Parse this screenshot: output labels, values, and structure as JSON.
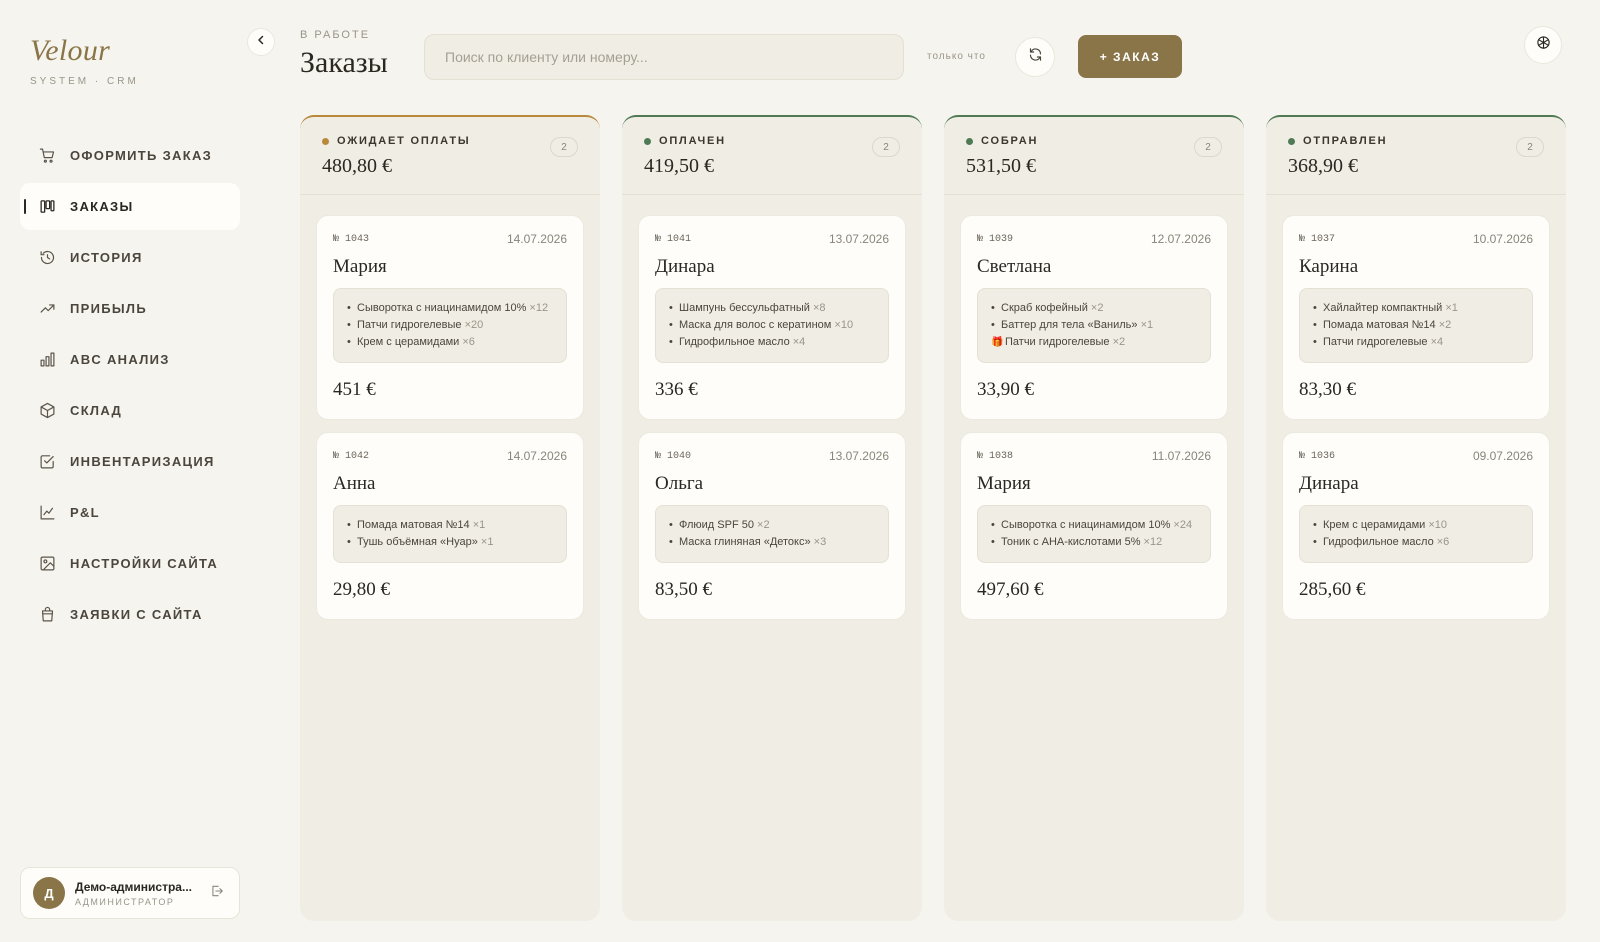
{
  "brand": {
    "name": "Velour",
    "subtitle": "SYSTEM · CRM"
  },
  "nav": [
    {
      "label": "ОФОРМИТЬ ЗАКАЗ",
      "icon": "cart-icon",
      "active": false
    },
    {
      "label": "ЗАКАЗЫ",
      "icon": "kanban-icon",
      "active": true
    },
    {
      "label": "ИСТОРИЯ",
      "icon": "history-icon",
      "active": false
    },
    {
      "label": "ПРИБЫЛЬ",
      "icon": "trending-up-icon",
      "active": false
    },
    {
      "label": "ABC АНАЛИЗ",
      "icon": "bar-chart-icon",
      "active": false
    },
    {
      "label": "СКЛАД",
      "icon": "box-icon",
      "active": false
    },
    {
      "label": "ИНВЕНТАРИЗАЦИЯ",
      "icon": "checklist-icon",
      "active": false
    },
    {
      "label": "P&L",
      "icon": "line-chart-icon",
      "active": false
    },
    {
      "label": "НАСТРОЙКИ САЙТА",
      "icon": "image-icon",
      "active": false
    },
    {
      "label": "ЗАЯВКИ С САЙТА",
      "icon": "bag-icon",
      "active": false
    }
  ],
  "user": {
    "initial": "Д",
    "name": "Демо-администра...",
    "role": "АДМИНИСТРАТОР"
  },
  "header": {
    "eyebrow": "В РАБОТЕ",
    "title": "Заказы",
    "search_placeholder": "Поиск по клиенту или номеру...",
    "updated": "только что",
    "new_order_label": "+ ЗАКАЗ"
  },
  "colors": {
    "accent": "#8a7549",
    "pending": "#b8893a",
    "done": "#4f7a55"
  },
  "columns": [
    {
      "status": "ОЖИДАЕТ ОПЛАТЫ",
      "count": "2",
      "total": "480,80 €",
      "color": "#b8893a",
      "orders": [
        {
          "number": "№ 1043",
          "date": "14.07.2026",
          "client": "Мария",
          "sum": "451 €",
          "items": [
            {
              "mark": "•",
              "name": "Сыворотка с ниацинамидом 10%",
              "qty": "×12"
            },
            {
              "mark": "•",
              "name": "Патчи гидрогелевые",
              "qty": "×20"
            },
            {
              "mark": "•",
              "name": "Крем с церамидами",
              "qty": "×6"
            }
          ]
        },
        {
          "number": "№ 1042",
          "date": "14.07.2026",
          "client": "Анна",
          "sum": "29,80 €",
          "items": [
            {
              "mark": "•",
              "name": "Помада матовая №14",
              "qty": "×1"
            },
            {
              "mark": "•",
              "name": "Тушь объёмная «Нуар»",
              "qty": "×1"
            }
          ]
        }
      ]
    },
    {
      "status": "ОПЛАЧЕН",
      "count": "2",
      "total": "419,50 €",
      "color": "#4f7a55",
      "orders": [
        {
          "number": "№ 1041",
          "date": "13.07.2026",
          "client": "Динара",
          "sum": "336 €",
          "items": [
            {
              "mark": "•",
              "name": "Шампунь бессульфатный",
              "qty": "×8"
            },
            {
              "mark": "•",
              "name": "Маска для волос с кератином",
              "qty": "×10"
            },
            {
              "mark": "•",
              "name": "Гидрофильное масло",
              "qty": "×4"
            }
          ]
        },
        {
          "number": "№ 1040",
          "date": "13.07.2026",
          "client": "Ольга",
          "sum": "83,50 €",
          "items": [
            {
              "mark": "•",
              "name": "Флюид SPF 50",
              "qty": "×2"
            },
            {
              "mark": "•",
              "name": "Маска глиняная «Детокс»",
              "qty": "×3"
            }
          ]
        }
      ]
    },
    {
      "status": "СОБРАН",
      "count": "2",
      "total": "531,50 €",
      "color": "#4f7a55",
      "orders": [
        {
          "number": "№ 1039",
          "date": "12.07.2026",
          "client": "Светлана",
          "sum": "33,90 €",
          "items": [
            {
              "mark": "•",
              "name": "Скраб кофейный",
              "qty": "×2"
            },
            {
              "mark": "•",
              "name": "Баттер для тела «Ваниль»",
              "qty": "×1"
            },
            {
              "mark": "🎁",
              "name": "Патчи гидрогелевые",
              "qty": "×2"
            }
          ]
        },
        {
          "number": "№ 1038",
          "date": "11.07.2026",
          "client": "Мария",
          "sum": "497,60 €",
          "items": [
            {
              "mark": "•",
              "name": "Сыворотка с ниацинамидом 10%",
              "qty": "×24"
            },
            {
              "mark": "•",
              "name": "Тоник с АНА-кислотами 5%",
              "qty": "×12"
            }
          ]
        }
      ]
    },
    {
      "status": "ОТПРАВЛЕН",
      "count": "2",
      "total": "368,90 €",
      "color": "#4f7a55",
      "orders": [
        {
          "number": "№ 1037",
          "date": "10.07.2026",
          "client": "Карина",
          "sum": "83,30 €",
          "items": [
            {
              "mark": "•",
              "name": "Хайлайтер компактный",
              "qty": "×1"
            },
            {
              "mark": "•",
              "name": "Помада матовая №14",
              "qty": "×2"
            },
            {
              "mark": "•",
              "name": "Патчи гидрогелевые",
              "qty": "×4"
            }
          ]
        },
        {
          "number": "№ 1036",
          "date": "09.07.2026",
          "client": "Динара",
          "sum": "285,60 €",
          "items": [
            {
              "mark": "•",
              "name": "Крем с церамидами",
              "qty": "×10"
            },
            {
              "mark": "•",
              "name": "Гидрофильное масло",
              "qty": "×6"
            }
          ]
        }
      ]
    }
  ]
}
